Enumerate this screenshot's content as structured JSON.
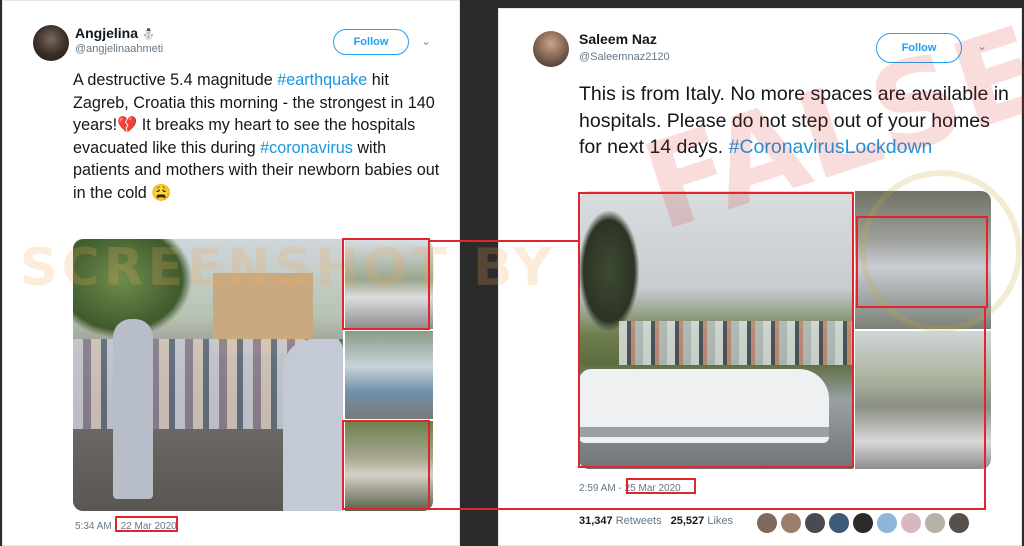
{
  "left_tweet": {
    "author_name": "Angjelina",
    "author_emoji": "⛄",
    "author_handle": "@angjelinaahmeti",
    "follow_label": "Follow",
    "text_part1": "A destructive 5.4 magnitude ",
    "hashtag_earthquake": "#earthquake",
    "text_part2": " hit Zagreb, Croatia this morning - the strongest in 140 years!",
    "broken_heart_emoji": "💔",
    "text_part3": " It breaks my heart to see the hospitals evacuated like this during ",
    "hashtag_coronavirus": "#coronavirus",
    "text_part4": " with patients and mothers with their newborn babies out in the cold ",
    "weary_emoji": "😩",
    "time": "5:34 AM -",
    "date": "22 Mar 2020"
  },
  "right_tweet": {
    "author_name": "Saleem Naz",
    "author_handle": "@Saleemnaz2120",
    "follow_label": "Follow",
    "text": "This is from Italy. No more spaces are available in hospitals.  Please do not step out of your homes for next 14 days.",
    "hashtag": "#CoronavirusLockdown",
    "time": "2:59 AM -",
    "date": "25 Mar 2020",
    "retweets_count": "31,347",
    "retweets_label": "Retweets",
    "likes_count": "25,527",
    "likes_label": "Likes"
  },
  "overlay": {
    "stamp_text": "FALSE",
    "watermark_text": "SCREENSHOT BY"
  },
  "colors": {
    "link": "#1b95e0",
    "highlight": "#e0262c",
    "follow": "#1da1f2"
  }
}
